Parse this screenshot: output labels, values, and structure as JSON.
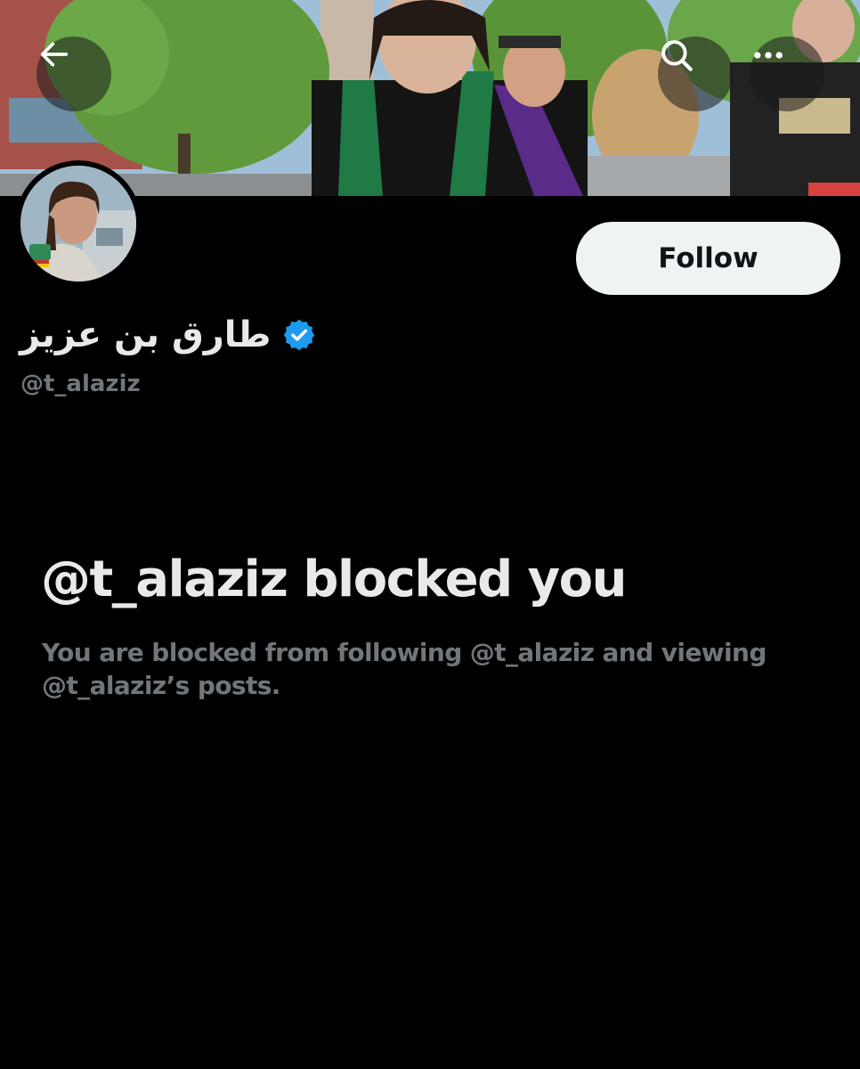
{
  "header": {
    "back_icon": "arrow-left-icon",
    "search_icon": "search-icon",
    "more_icon": "more-horizontal-icon"
  },
  "profile": {
    "display_name": "طارق بن عزيز",
    "verified_icon": "verified-badge-icon",
    "verified_color": "#1d9bf0",
    "handle": "@t_alaziz",
    "follow_label": "Follow"
  },
  "blocked": {
    "title": "@t_alaziz blocked you",
    "description": "You are blocked from following @t_alaziz and viewing @t_alaziz’s posts."
  },
  "colors": {
    "background": "#000000",
    "primary_text": "#e7e9ea",
    "secondary_text": "#71767b",
    "follow_button_bg": "#eff3f4",
    "follow_button_text": "#0f1419"
  }
}
